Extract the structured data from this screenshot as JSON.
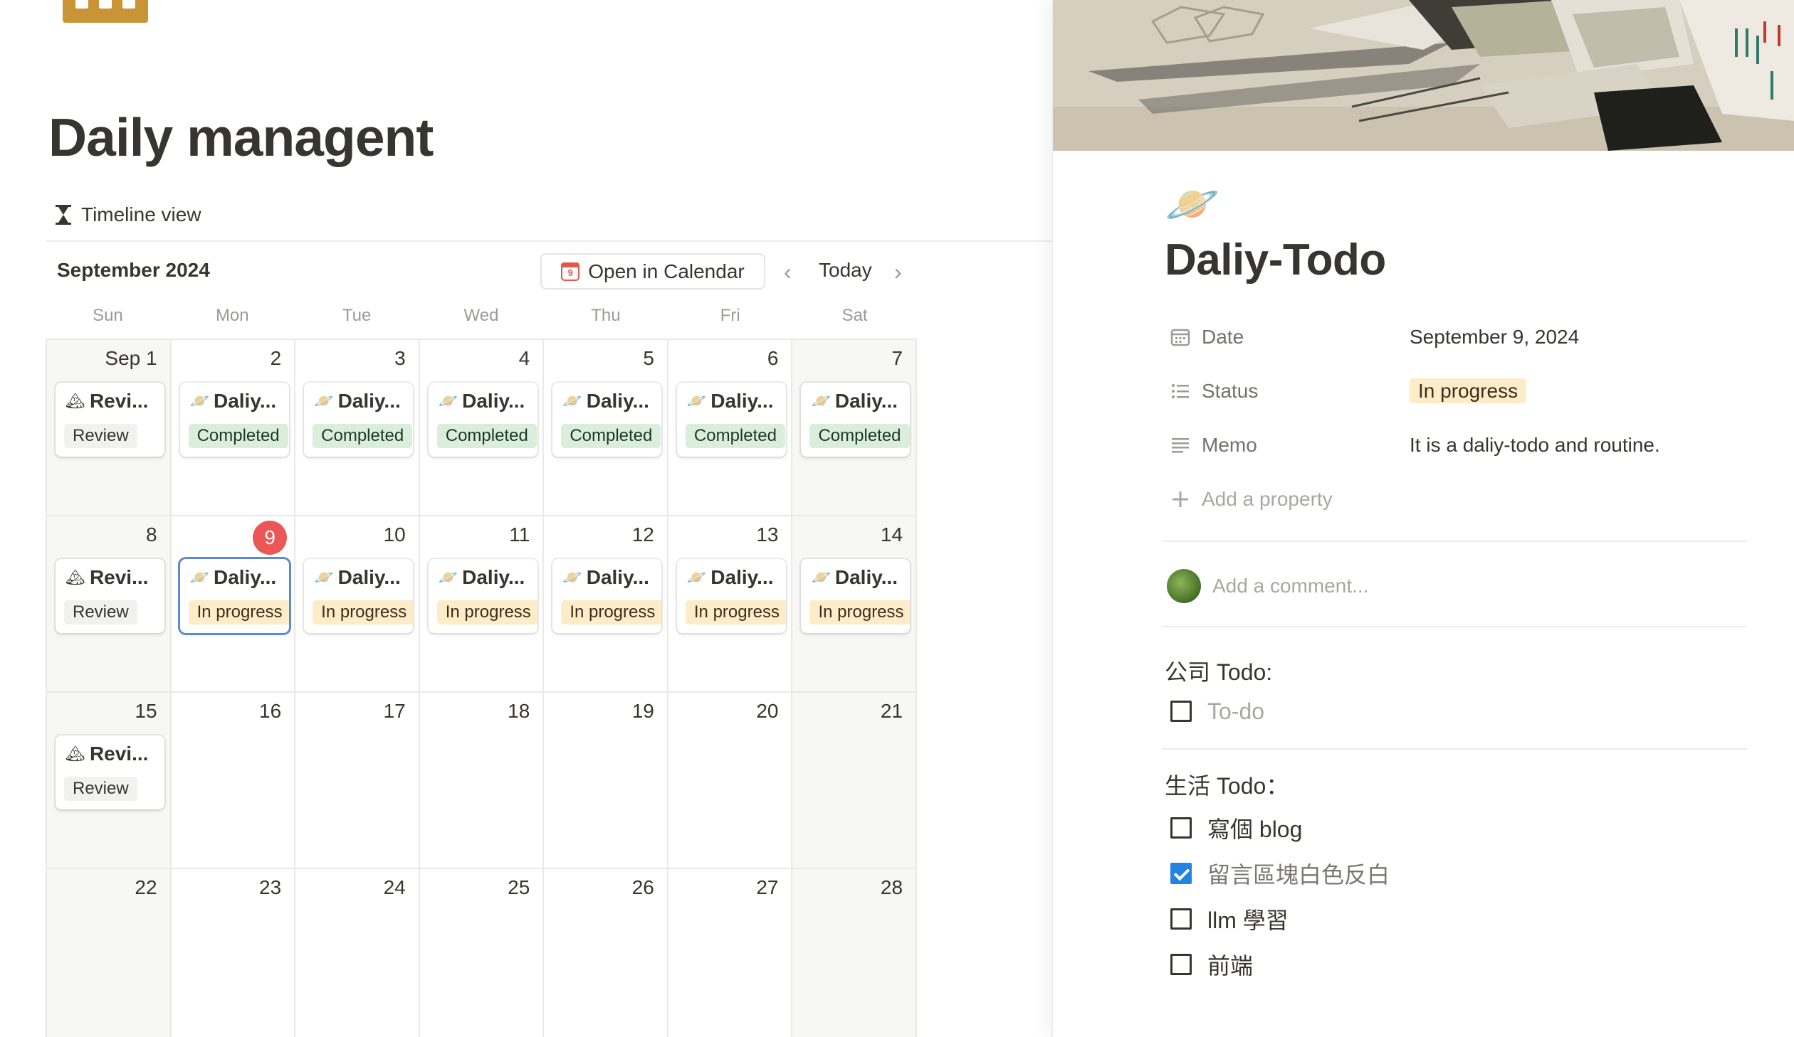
{
  "page": {
    "title": "Daily managent",
    "view_tab": "Timeline view"
  },
  "calendar": {
    "month_label": "September 2024",
    "open_in_calendar": "Open in Calendar",
    "calendar_icon_day": "9",
    "today_label": "Today",
    "weekdays": [
      "Sun",
      "Mon",
      "Tue",
      "Wed",
      "Thu",
      "Fri",
      "Sat"
    ],
    "weeks": [
      [
        {
          "label": "Sep 1",
          "card": {
            "icon": "mountain-icon",
            "glyph": "🏔",
            "title": "Revi...",
            "tag": "Review",
            "kind": "review"
          }
        },
        {
          "label": "2",
          "card": {
            "icon": "saturn-icon",
            "glyph": "🪐",
            "title": "Daliy...",
            "tag": "Completed",
            "kind": "completed"
          }
        },
        {
          "label": "3",
          "card": {
            "icon": "saturn-icon",
            "glyph": "🪐",
            "title": "Daliy...",
            "tag": "Completed",
            "kind": "completed"
          }
        },
        {
          "label": "4",
          "card": {
            "icon": "saturn-icon",
            "glyph": "🪐",
            "title": "Daliy...",
            "tag": "Completed",
            "kind": "completed"
          }
        },
        {
          "label": "5",
          "card": {
            "icon": "saturn-icon",
            "glyph": "🪐",
            "title": "Daliy...",
            "tag": "Completed",
            "kind": "completed"
          }
        },
        {
          "label": "6",
          "card": {
            "icon": "saturn-icon",
            "glyph": "🪐",
            "title": "Daliy...",
            "tag": "Completed",
            "kind": "completed"
          }
        },
        {
          "label": "7",
          "card": {
            "icon": "saturn-icon",
            "glyph": "🪐",
            "title": "Daliy...",
            "tag": "Completed",
            "kind": "completed"
          }
        }
      ],
      [
        {
          "label": "8",
          "card": {
            "icon": "mountain-icon",
            "glyph": "🏔",
            "title": "Revi...",
            "tag": "Review",
            "kind": "review"
          }
        },
        {
          "label": "9",
          "today": true,
          "card": {
            "icon": "saturn-icon",
            "glyph": "🪐",
            "title": "Daliy...",
            "tag": "In progress",
            "kind": "progress",
            "selected": true
          }
        },
        {
          "label": "10",
          "card": {
            "icon": "saturn-icon",
            "glyph": "🪐",
            "title": "Daliy...",
            "tag": "In progress",
            "kind": "progress"
          }
        },
        {
          "label": "11",
          "card": {
            "icon": "saturn-icon",
            "glyph": "🪐",
            "title": "Daliy...",
            "tag": "In progress",
            "kind": "progress"
          }
        },
        {
          "label": "12",
          "card": {
            "icon": "saturn-icon",
            "glyph": "🪐",
            "title": "Daliy...",
            "tag": "In progress",
            "kind": "progress"
          }
        },
        {
          "label": "13",
          "card": {
            "icon": "saturn-icon",
            "glyph": "🪐",
            "title": "Daliy...",
            "tag": "In progress",
            "kind": "progress"
          }
        },
        {
          "label": "14",
          "card": {
            "icon": "saturn-icon",
            "glyph": "🪐",
            "title": "Daliy...",
            "tag": "In progress",
            "kind": "progress"
          }
        }
      ],
      [
        {
          "label": "15",
          "card": {
            "icon": "mountain-icon",
            "glyph": "🏔",
            "title": "Revi...",
            "tag": "Review",
            "kind": "review"
          }
        },
        {
          "label": "16"
        },
        {
          "label": "17"
        },
        {
          "label": "18"
        },
        {
          "label": "19"
        },
        {
          "label": "20"
        },
        {
          "label": "21"
        }
      ],
      [
        {
          "label": "22"
        },
        {
          "label": "23"
        },
        {
          "label": "24"
        },
        {
          "label": "25"
        },
        {
          "label": "26"
        },
        {
          "label": "27"
        },
        {
          "label": "28"
        }
      ]
    ]
  },
  "peek": {
    "icon": "🪐",
    "title": "Daliy-Todo",
    "properties": {
      "date_label": "Date",
      "date_value": "September 9, 2024",
      "status_label": "Status",
      "status_value": "In progress",
      "memo_label": "Memo",
      "memo_value": "It is a daliy-todo and routine.",
      "add_property": "Add a property"
    },
    "comment_placeholder": "Add a comment...",
    "company_section": "公司 Todo:",
    "company_todos": [
      {
        "text": "To-do",
        "checked": false,
        "placeholder": true
      }
    ],
    "life_section": "生活 Todo：",
    "life_todos": [
      {
        "text": "寫個 blog",
        "checked": false
      },
      {
        "text": "留言區塊白色反白",
        "checked": true
      },
      {
        "text": "llm 學習",
        "checked": false
      },
      {
        "text": "前端",
        "checked": false
      }
    ]
  },
  "colors": {
    "completed_bg": "#dbeddb",
    "progress_bg": "#fdecc8",
    "review_bg": "#f1f1ef",
    "today_red": "#eb5757",
    "selected_blue": "#5b8bd4",
    "checkbox_blue": "#2383e2",
    "page_icon": "#c89435"
  }
}
